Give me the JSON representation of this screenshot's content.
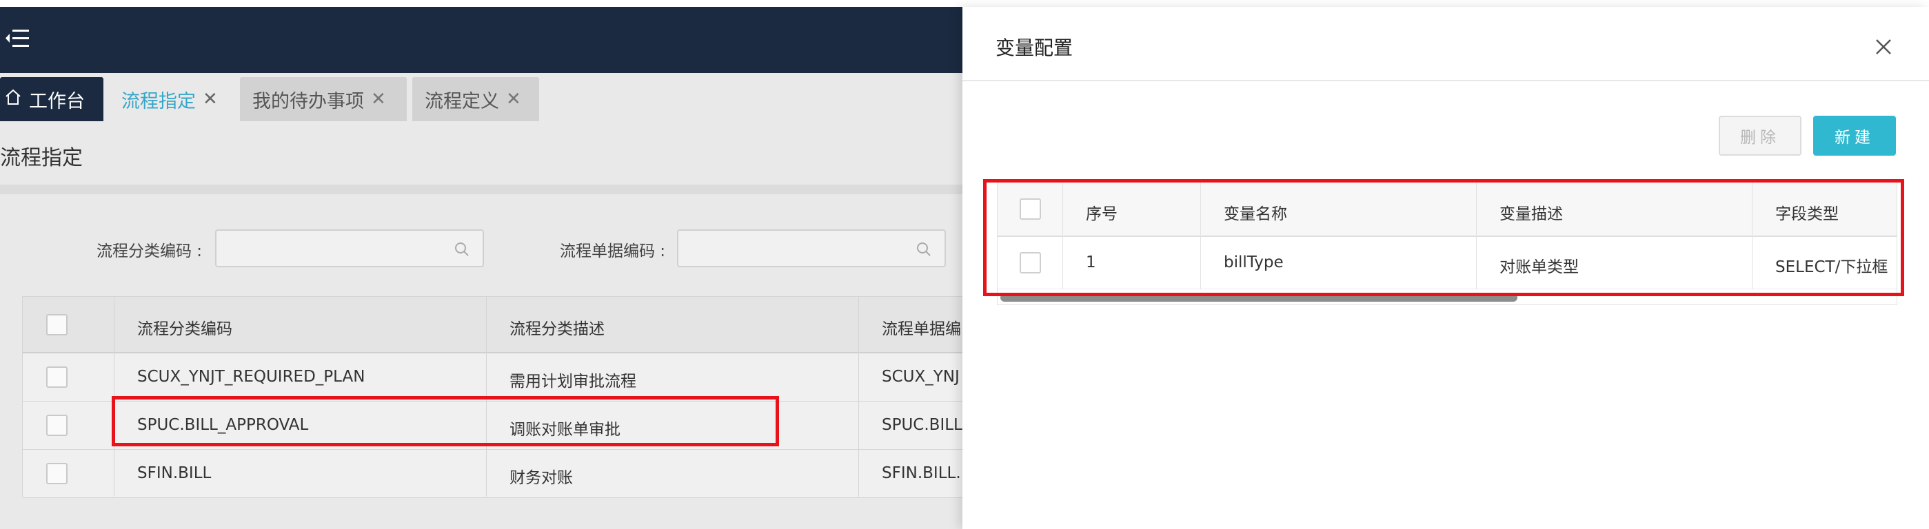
{
  "tabs": [
    {
      "label": "工作台",
      "closable": false
    },
    {
      "label": "流程指定",
      "closable": true,
      "active": true
    },
    {
      "label": "我的待办事项",
      "closable": true
    },
    {
      "label": "流程定义",
      "closable": true
    }
  ],
  "page": {
    "title": "流程指定",
    "filters": {
      "category_code_label": "流程分类编码 :",
      "category_code_value": "",
      "bill_code_label": "流程单据编码 :",
      "bill_code_value": ""
    }
  },
  "grid": {
    "columns": [
      "流程分类编码",
      "流程分类描述",
      "流程单据编"
    ],
    "rows": [
      [
        "SCUX_YNJT_REQUIRED_PLAN",
        "需用计划审批流程",
        "SCUX_YNJ"
      ],
      [
        "SPUC.BILL_APPROVAL",
        "调账对账单审批",
        "SPUC.BILL"
      ],
      [
        "SFIN.BILL",
        "财务对账",
        "SFIN.BILL."
      ]
    ]
  },
  "drawer": {
    "title": "变量配置",
    "buttons": {
      "delete": "删除",
      "new": "新建"
    },
    "columns": [
      "序号",
      "变量名称",
      "变量描述",
      "字段类型"
    ],
    "rows": [
      [
        "1",
        "billType",
        "对账单类型",
        "SELECT/下拉框"
      ]
    ]
  },
  "colors": {
    "header_dark": "#1b2a40",
    "accent_cyan": "#2fb8d0",
    "highlight_red": "#e8121b"
  },
  "icons": [
    "menu-icon",
    "home-icon",
    "close-icon",
    "search-icon"
  ]
}
